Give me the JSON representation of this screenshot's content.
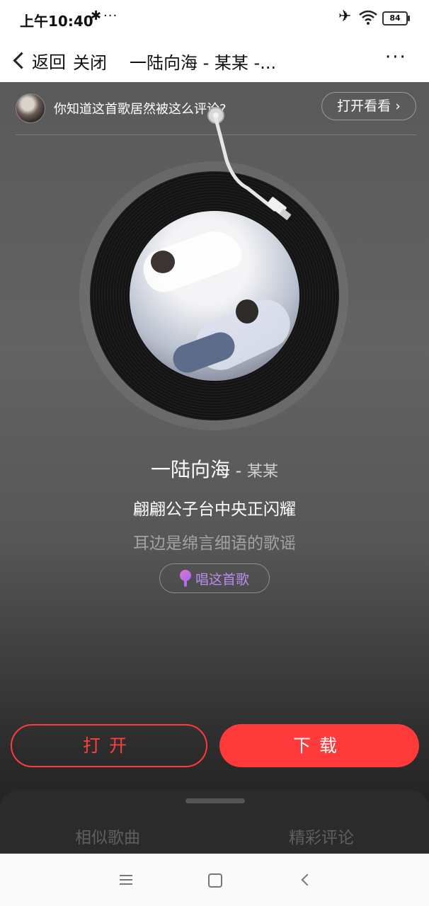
{
  "status_bar": {
    "time": "上午10:40",
    "more_indicator": "···",
    "battery": "84",
    "icons": [
      "bluetooth-icon",
      "airplane-icon",
      "wifi-icon",
      "battery-icon"
    ]
  },
  "nav": {
    "back_label": "返回",
    "close_label": "关闭",
    "title": "一陆向海 - 某某 -...",
    "more_label": "···"
  },
  "banner": {
    "text": "你知道这首歌居然被这么评论?",
    "button_label": "打开看看 ›"
  },
  "song": {
    "name": "一陆向海",
    "separator": " - ",
    "artist": "某某"
  },
  "lyrics": {
    "current": "翩翩公子台中央正闪耀",
    "next": "耳边是绵言细语的歌谣"
  },
  "sing_button": {
    "label": "唱这首歌"
  },
  "actions": {
    "open_label": "打开",
    "download_label": "下载"
  },
  "bottom_tabs": [
    "相似歌曲",
    "精彩评论"
  ],
  "colors": {
    "accent": "#ff3a3a",
    "sing_purple": "#b98cf0"
  }
}
